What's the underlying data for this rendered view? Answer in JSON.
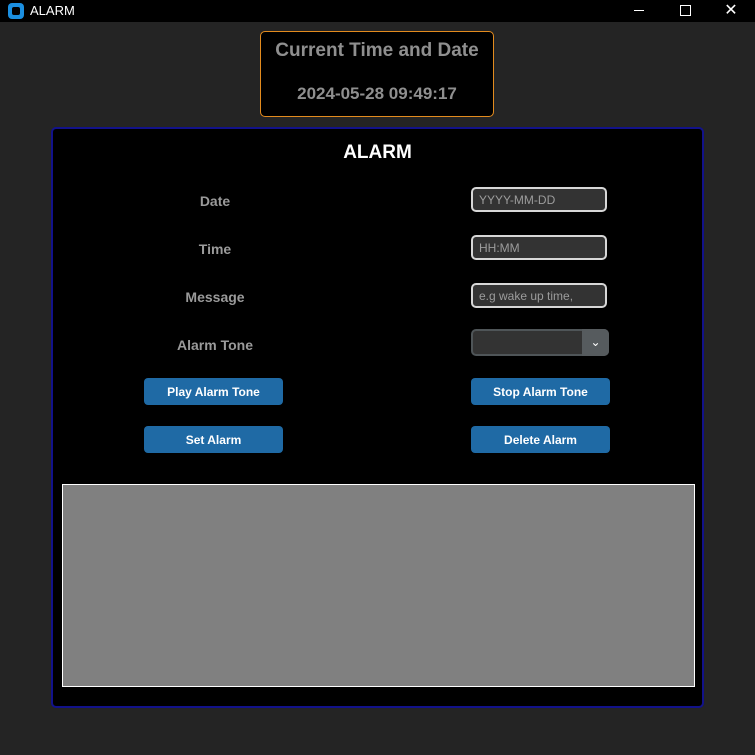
{
  "window": {
    "title": "ALARM",
    "minimize_glyph": "",
    "maximize_glyph": "",
    "close_glyph": "✕"
  },
  "clock": {
    "title": "Current Time and Date",
    "value": "2024-05-28 09:49:17"
  },
  "alarm": {
    "heading": "ALARM",
    "date": {
      "label": "Date",
      "placeholder": "YYYY-MM-DD",
      "value": ""
    },
    "time": {
      "label": "Time",
      "placeholder": "HH:MM",
      "value": ""
    },
    "message": {
      "label": "Message",
      "placeholder": "e.g wake up time,",
      "value": ""
    },
    "tone": {
      "label": "Alarm Tone",
      "selected": "",
      "arrow": "⌄"
    },
    "buttons": {
      "play": "Play Alarm Tone",
      "stop": "Stop Alarm Tone",
      "set": "Set Alarm",
      "delete": "Delete Alarm"
    },
    "output_text": ""
  },
  "colors": {
    "window_bg": "#242424",
    "panel_bg": "#000000",
    "panel_border": "#12128a",
    "clock_border": "#e38b1e",
    "button": "#1f6aa5",
    "output_bg": "#808080"
  },
  "icons": {
    "app": "app-icon",
    "minimize": "minimize-icon",
    "maximize": "maximize-icon",
    "close": "close-icon",
    "dropdown": "chevron-down-icon"
  }
}
